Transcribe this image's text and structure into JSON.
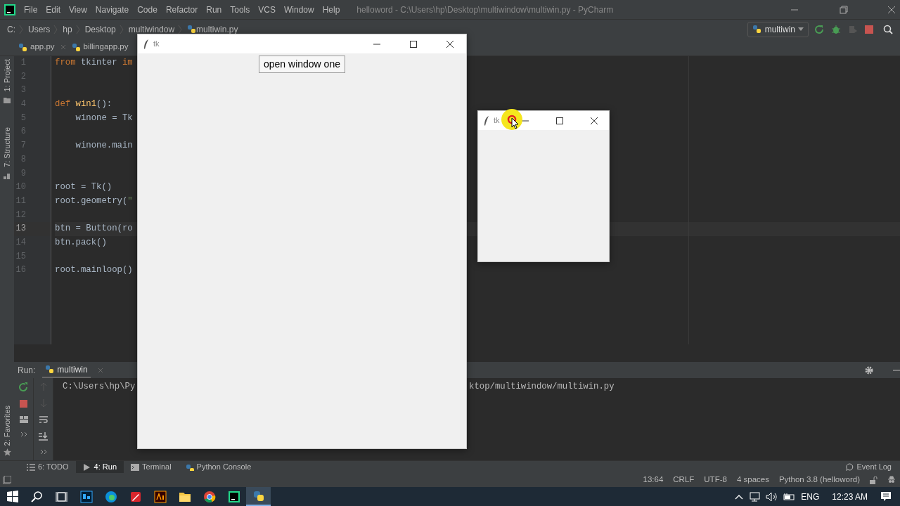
{
  "ide": {
    "title": "helloword - C:\\Users\\hp\\Desktop\\multiwindow\\multiwin.py - PyCharm",
    "menu": [
      "File",
      "Edit",
      "View",
      "Navigate",
      "Code",
      "Refactor",
      "Run",
      "Tools",
      "VCS",
      "Window",
      "Help"
    ],
    "breadcrumbs": [
      "C:",
      "Users",
      "hp",
      "Desktop",
      "multiwindow",
      "multiwin.py"
    ],
    "run_config": "multiwin",
    "tabs": [
      {
        "label": "app.py",
        "selected": false
      },
      {
        "label": "billingapp.py",
        "selected": false
      }
    ],
    "side_tools": [
      "1: Project",
      "7: Structure"
    ],
    "code_lines": [
      {
        "number": "1",
        "current": false,
        "segments": [
          {
            "text": "from",
            "kind": "keyword"
          },
          {
            "text": " tkinter ",
            "kind": "plain"
          },
          {
            "text": "im",
            "kind": "keyword"
          }
        ]
      },
      {
        "number": "2",
        "current": false
      },
      {
        "number": "3",
        "current": false
      },
      {
        "number": "4",
        "current": false,
        "segments": [
          {
            "text": "def",
            "kind": "keyword"
          },
          {
            "text": " win1",
            "kind": "function"
          },
          {
            "text": "():",
            "kind": "plain"
          }
        ]
      },
      {
        "number": "5",
        "current": false,
        "segments": [
          {
            "text": "    winone = Tk",
            "kind": "plain"
          }
        ]
      },
      {
        "number": "6",
        "current": false
      },
      {
        "number": "7",
        "current": false,
        "segments": [
          {
            "text": "    winone.main",
            "kind": "plain"
          }
        ]
      },
      {
        "number": "8",
        "current": false
      },
      {
        "number": "9",
        "current": false
      },
      {
        "number": "10",
        "current": false,
        "segments": [
          {
            "text": "root = Tk()",
            "kind": "plain"
          }
        ]
      },
      {
        "number": "11",
        "current": false,
        "segments": [
          {
            "text": "root.geometry(",
            "kind": "plain"
          },
          {
            "text": "\"",
            "kind": "string"
          }
        ]
      },
      {
        "number": "12",
        "current": false
      },
      {
        "number": "13",
        "current": true,
        "segments": [
          {
            "text": "btn = Button(ro",
            "kind": "plain"
          }
        ]
      },
      {
        "number": "14",
        "current": false,
        "segments": [
          {
            "text": "btn.pack()",
            "kind": "plain"
          }
        ]
      },
      {
        "number": "15",
        "current": false
      },
      {
        "number": "16",
        "current": false,
        "segments": [
          {
            "text": "root.mainloop()",
            "kind": "plain"
          }
        ]
      }
    ],
    "run_panel": {
      "label": "Run:",
      "tab": "multiwin",
      "console": [
        "C:\\Users\\hp\\Py",
        "ktop/multiwindow/multiwin.py"
      ]
    },
    "favorites": "2: Favorites",
    "tool_tabs": [
      {
        "label": "6: TODO",
        "kind": "list",
        "selected": false
      },
      {
        "label": "4: Run",
        "kind": "run",
        "selected": true
      },
      {
        "label": "Terminal",
        "kind": "terminal",
        "selected": false
      },
      {
        "label": "Python Console",
        "kind": "python",
        "selected": false
      }
    ],
    "event_log": "Event Log",
    "status": [
      "13:64",
      "CRLF",
      "UTF-8",
      "4 spaces",
      "Python 3.8 (helloword)"
    ]
  },
  "tk_windows": [
    {
      "title": "tk",
      "button": "open window one"
    },
    {
      "title": "tk"
    }
  ],
  "taskbar": {
    "apps": [
      {
        "kind": "photoshop",
        "selected": false
      },
      {
        "kind": "edge",
        "selected": false
      },
      {
        "kind": "pen",
        "selected": false
      },
      {
        "kind": "illustrator",
        "selected": false
      },
      {
        "kind": "folder",
        "selected": false
      },
      {
        "kind": "chrome",
        "selected": false
      },
      {
        "kind": "pycharm",
        "selected": false
      },
      {
        "kind": "python",
        "selected": true
      }
    ],
    "language": "ENG",
    "clock": "12:23 AM"
  }
}
